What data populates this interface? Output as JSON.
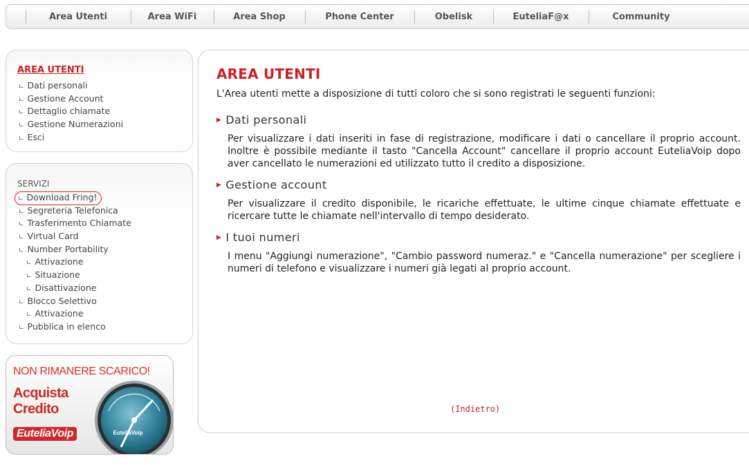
{
  "topnav": {
    "items": [
      {
        "label": "Area Utenti"
      },
      {
        "label": "Area WiFi"
      },
      {
        "label": "Area Shop"
      },
      {
        "label": "Phone Center"
      },
      {
        "label": "Obelisk"
      },
      {
        "label": "EuteliaF@x"
      },
      {
        "label": "Community"
      }
    ]
  },
  "sidebar": {
    "area_utenti": {
      "title": "AREA UTENTI",
      "items": [
        "Dati personali",
        "Gestione Account",
        "Dettaglio chiamate",
        "Gestione Numerazioni",
        "Esci"
      ]
    },
    "servizi": {
      "heading": "SERVIZI",
      "items": [
        "Download Fring!",
        "Segreteria Telefonica",
        "Trasferimento Chiamate",
        "Virtual Card",
        "Number Portability",
        "Attivazione",
        "Situazione",
        "Disattivazione",
        "Blocco Selettivo",
        "Attivazione",
        "Pubblica in elenco"
      ]
    },
    "arrow_icon": "arrow-corner-icon"
  },
  "promo": {
    "headline": "NON RIMANERE SCARICO!",
    "line1": "Acquista",
    "line2": "Credito",
    "badge": "EuteliaVoip",
    "gauge_label": "EuteliaVoip"
  },
  "main": {
    "title": "AREA UTENTI",
    "intro": "L'Area utenti mette a disposizione di tutti coloro che si sono registrati le seguenti funzioni:",
    "sections": [
      {
        "title": "Dati personali",
        "body": "Per visualizzare i dati inseriti in fase di registrazione, modificare i dati o cancellare il proprio account. Inoltre è possibile mediante il tasto \"Cancella Account\" cancellare il proprio account EuteliaVoip dopo aver cancellato le numerazioni ed utilizzato tutto il credito a disposizione."
      },
      {
        "title": "Gestione account",
        "body": "Per visualizzare il credito disponibile, le ricariche effettuate, le ultime cinque chiamate effettuate e ricercare tutte le chiamate nell'intervallo di tempo desiderato."
      },
      {
        "title": "I tuoi numeri",
        "body": "I menu \"Aggiungi numerazione\", \"Cambio password numeraz.\" e \"Cancella numerazione\" per scegliere i numeri di telefono e visualizzare i numeri già legati al proprio account."
      }
    ],
    "back_link": "(Indietro)"
  },
  "colors": {
    "accent_red": "#cc1f24",
    "nav_text": "#555555",
    "border": "#d0d0d0"
  }
}
